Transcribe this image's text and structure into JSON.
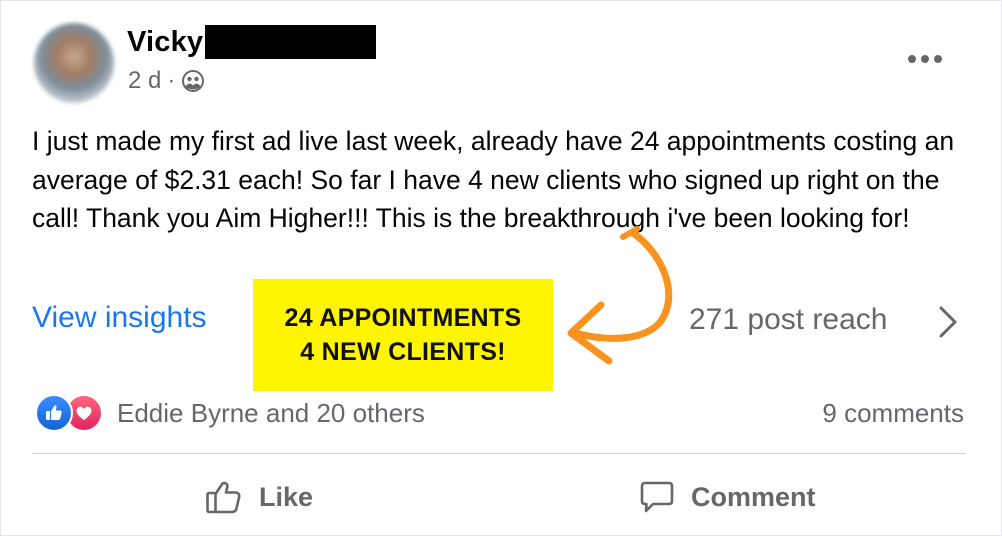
{
  "post": {
    "author_name": "Vicky",
    "time": "2 d",
    "separator": "·",
    "privacy_icon": "friends-icon",
    "text": "I just made my first ad live last week, already have 24 appointments costing an average of $2.31 each! So far I have 4 new clients who signed up right on the call! Thank you Aim Higher!!! This is the breakthrough i've been looking for!",
    "insights_label": "View insights",
    "highlight": {
      "line1": "24 APPOINTMENTS",
      "line2": "4 NEW CLIENTS!",
      "color": "#fff500"
    },
    "annotation_arrow_color": "#f7931e",
    "reach_label": "271 post reach",
    "reactions_text": "Eddie Byrne and 20 others",
    "reaction_icons": [
      "like-icon",
      "love-icon"
    ],
    "comments_label": "9 comments"
  },
  "actions": {
    "like_label": "Like",
    "comment_label": "Comment"
  },
  "colors": {
    "link_blue": "#1877f2",
    "secondary_text": "#65676b"
  }
}
